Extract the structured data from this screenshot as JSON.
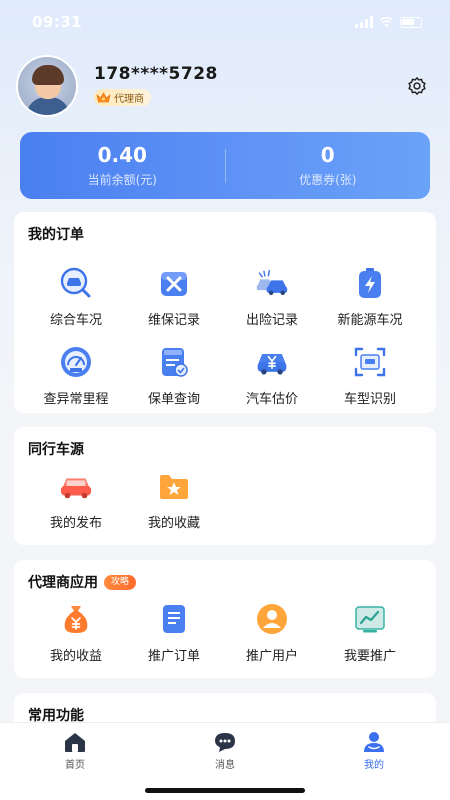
{
  "status_bar": {
    "time": "09:31"
  },
  "profile": {
    "phone": "178****5728",
    "badge": "代理商"
  },
  "balance": {
    "balance_value": "0.40",
    "balance_label": "当前余额(元)",
    "coupon_value": "0",
    "coupon_label": "优惠券(张)"
  },
  "orders": {
    "title": "我的订单",
    "items": [
      {
        "label": "综合车况",
        "icon": "car-inspect-icon"
      },
      {
        "label": "维保记录",
        "icon": "maintenance-icon"
      },
      {
        "label": "出险记录",
        "icon": "accident-icon"
      },
      {
        "label": "新能源车况",
        "icon": "battery-icon"
      },
      {
        "label": "查异常里程",
        "icon": "speedometer-icon"
      },
      {
        "label": "保单查询",
        "icon": "policy-icon"
      },
      {
        "label": "汽车估价",
        "icon": "car-price-icon"
      },
      {
        "label": "车型识别",
        "icon": "vin-scan-icon"
      }
    ]
  },
  "peer_cars": {
    "title": "同行车源",
    "items": [
      {
        "label": "我的发布",
        "icon": "car-publish-icon"
      },
      {
        "label": "我的收藏",
        "icon": "star-folder-icon"
      }
    ]
  },
  "agent_apps": {
    "title": "代理商应用",
    "tag": "攻略",
    "items": [
      {
        "label": "我的收益",
        "icon": "money-bag-icon"
      },
      {
        "label": "推广订单",
        "icon": "document-icon"
      },
      {
        "label": "推广用户",
        "icon": "user-icon"
      },
      {
        "label": "我要推广",
        "icon": "trend-chart-icon"
      }
    ]
  },
  "common": {
    "title": "常用功能"
  },
  "nav": [
    {
      "label": "首页",
      "icon": "home-icon"
    },
    {
      "label": "消息",
      "icon": "message-icon"
    },
    {
      "label": "我的",
      "icon": "profile-icon"
    }
  ],
  "colors": {
    "accent": "#4a7ff0",
    "orange": "#ff6b2c",
    "nav_active": "#3a6ff0"
  }
}
